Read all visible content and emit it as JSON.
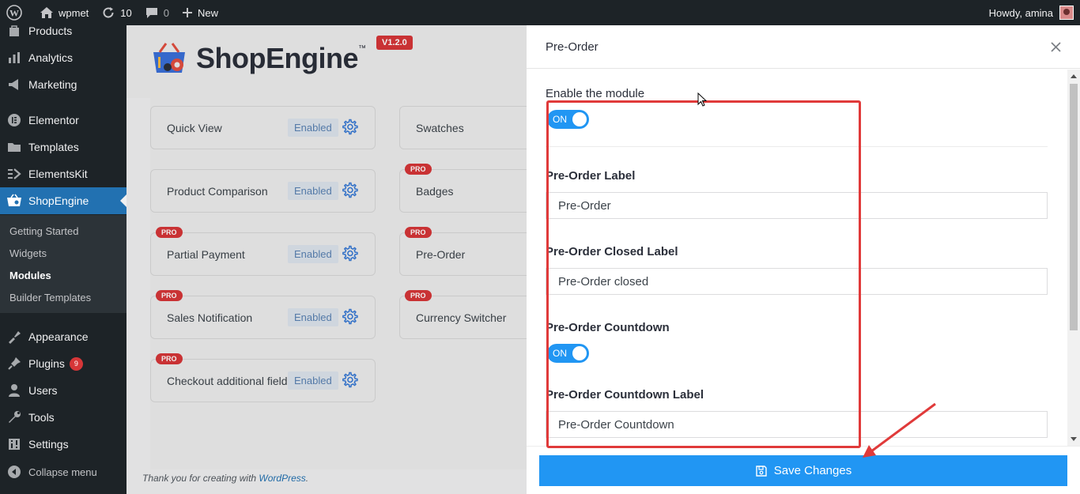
{
  "admin_bar": {
    "site_name": "wpmet",
    "updates_count": "10",
    "comments_count": "0",
    "new_label": "New",
    "greeting": "Howdy, amina"
  },
  "sidebar": {
    "items": [
      {
        "label": "Products",
        "icon": "products-icon"
      },
      {
        "label": "Analytics",
        "icon": "analytics-icon"
      },
      {
        "label": "Marketing",
        "icon": "marketing-icon"
      },
      {
        "label": "Elementor",
        "icon": "elementor-icon"
      },
      {
        "label": "Templates",
        "icon": "templates-icon"
      },
      {
        "label": "ElementsKit",
        "icon": "elementskit-icon"
      },
      {
        "label": "ShopEngine",
        "icon": "shopengine-icon"
      },
      {
        "label": "Appearance",
        "icon": "appearance-icon"
      },
      {
        "label": "Plugins",
        "icon": "plugins-icon",
        "badge": "9"
      },
      {
        "label": "Users",
        "icon": "users-icon"
      },
      {
        "label": "Tools",
        "icon": "tools-icon"
      },
      {
        "label": "Settings",
        "icon": "settings-icon"
      }
    ],
    "submenu": [
      "Getting Started",
      "Widgets",
      "Modules",
      "Builder Templates"
    ],
    "collapse_label": "Collapse menu"
  },
  "brand": {
    "name": "ShopEngine",
    "trademark": "™",
    "version": "V1.2.0"
  },
  "modules": [
    {
      "label": "Quick View",
      "status": "Enabled",
      "pro": false
    },
    {
      "label": "Swatches",
      "status": "",
      "pro": false
    },
    {
      "label": "Product Comparison",
      "status": "Enabled",
      "pro": false
    },
    {
      "label": "Badges",
      "status": "",
      "pro": true
    },
    {
      "label": "Partial Payment",
      "status": "Enabled",
      "pro": true
    },
    {
      "label": "Pre-Order",
      "status": "",
      "pro": true
    },
    {
      "label": "Sales Notification",
      "status": "Enabled",
      "pro": true
    },
    {
      "label": "Currency Switcher",
      "status": "",
      "pro": true
    },
    {
      "label": "Checkout additional field",
      "status": "Enabled",
      "pro": true
    }
  ],
  "pro_label": "PRO",
  "footer": {
    "text": "Thank you for creating with ",
    "link": "WordPress",
    "period": "."
  },
  "modal": {
    "title": "Pre-Order",
    "enable_label": "Enable the module",
    "enable_toggle": "ON",
    "label_title": "Pre-Order Label",
    "label_value": "Pre-Order",
    "closed_title": "Pre-Order Closed Label",
    "closed_value": "Pre-Order closed",
    "countdown_title": "Pre-Order Countdown",
    "countdown_toggle": "ON",
    "countdown_label_title": "Pre-Order Countdown Label",
    "countdown_label_value": "Pre-Order Countdown",
    "save_label": "Save Changes"
  },
  "colors": {
    "wp_dark": "#1d2327",
    "wp_blue": "#2271b1",
    "accent": "#2196f3",
    "annotation": "#e03a3a"
  }
}
